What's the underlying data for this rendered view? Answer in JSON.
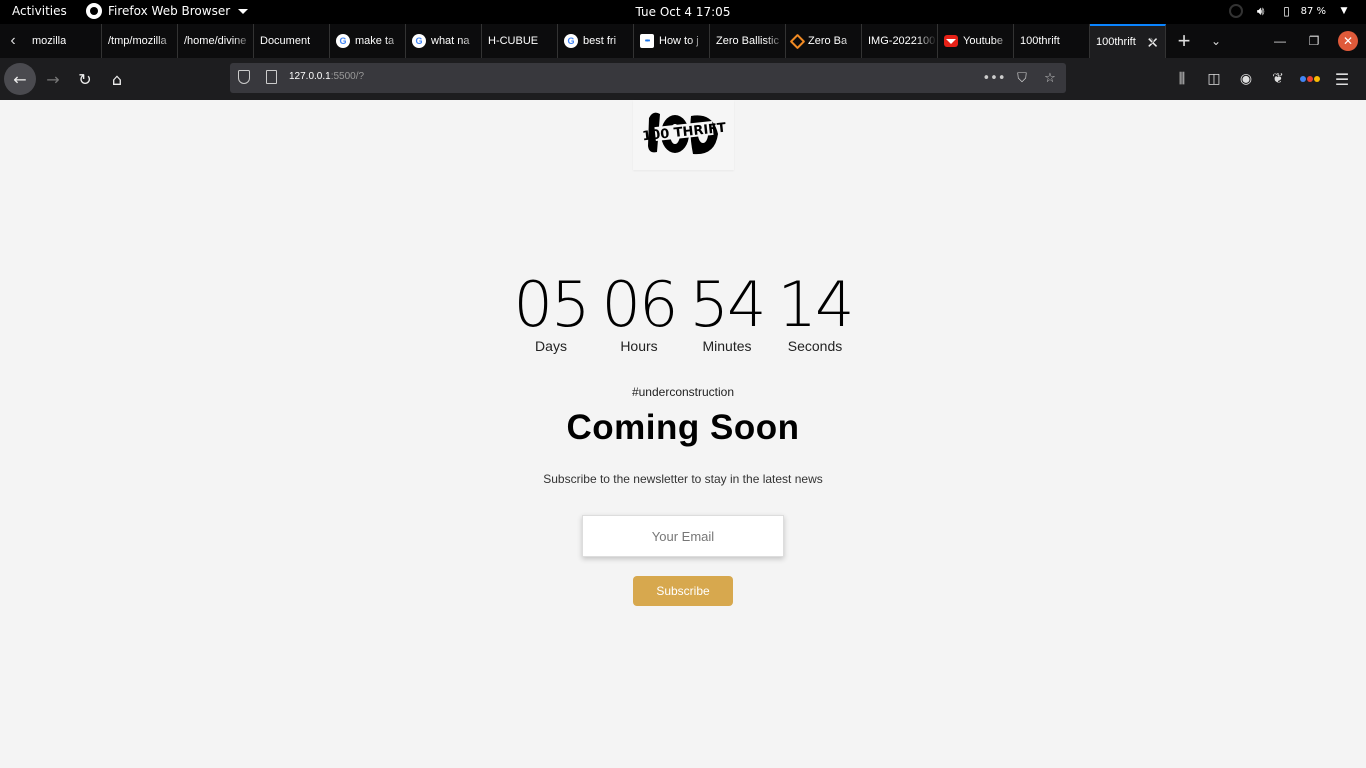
{
  "topbar": {
    "activities": "Activities",
    "app_name": "Firefox Web Browser",
    "clock": "Tue Oct 4  17:05",
    "battery_pct": "87 %"
  },
  "tabs": [
    {
      "title": "mozilla",
      "favicon": "none"
    },
    {
      "title": "/tmp/mozilla",
      "favicon": "none"
    },
    {
      "title": "/home/divine",
      "favicon": "none"
    },
    {
      "title": "Document",
      "favicon": "none"
    },
    {
      "title": "make ta",
      "favicon": "google"
    },
    {
      "title": "what na",
      "favicon": "google"
    },
    {
      "title": "H-CUBUE",
      "favicon": "none"
    },
    {
      "title": "best fri",
      "favicon": "google"
    },
    {
      "title": "How to j",
      "favicon": "dots-blue"
    },
    {
      "title": "Zero Ballistic",
      "favicon": "none"
    },
    {
      "title": "Zero Ba",
      "favicon": "zero-ballistics"
    },
    {
      "title": "IMG-2022100",
      "favicon": "none"
    },
    {
      "title": "Youtube",
      "favicon": "youtube"
    },
    {
      "title": "100thrift",
      "favicon": "none"
    },
    {
      "title": "100thrift",
      "favicon": "none",
      "active": true
    }
  ],
  "navbar": {
    "url_host": "127.0.0.1",
    "url_rest": ":5500/?"
  },
  "page": {
    "logo_text": "100 THRIFT",
    "countdown": [
      {
        "value": "05",
        "label": "Days"
      },
      {
        "value": "06",
        "label": "Hours"
      },
      {
        "value": "54",
        "label": "Minutes"
      },
      {
        "value": "14",
        "label": "Seconds"
      }
    ],
    "hashtag": "#underconstruction",
    "heading": "Coming Soon",
    "subtitle": "Subscribe to the newsletter to stay in the latest news",
    "email_placeholder": "Your Email",
    "subscribe_label": "Subscribe",
    "accent_color": "#d7a84e"
  }
}
